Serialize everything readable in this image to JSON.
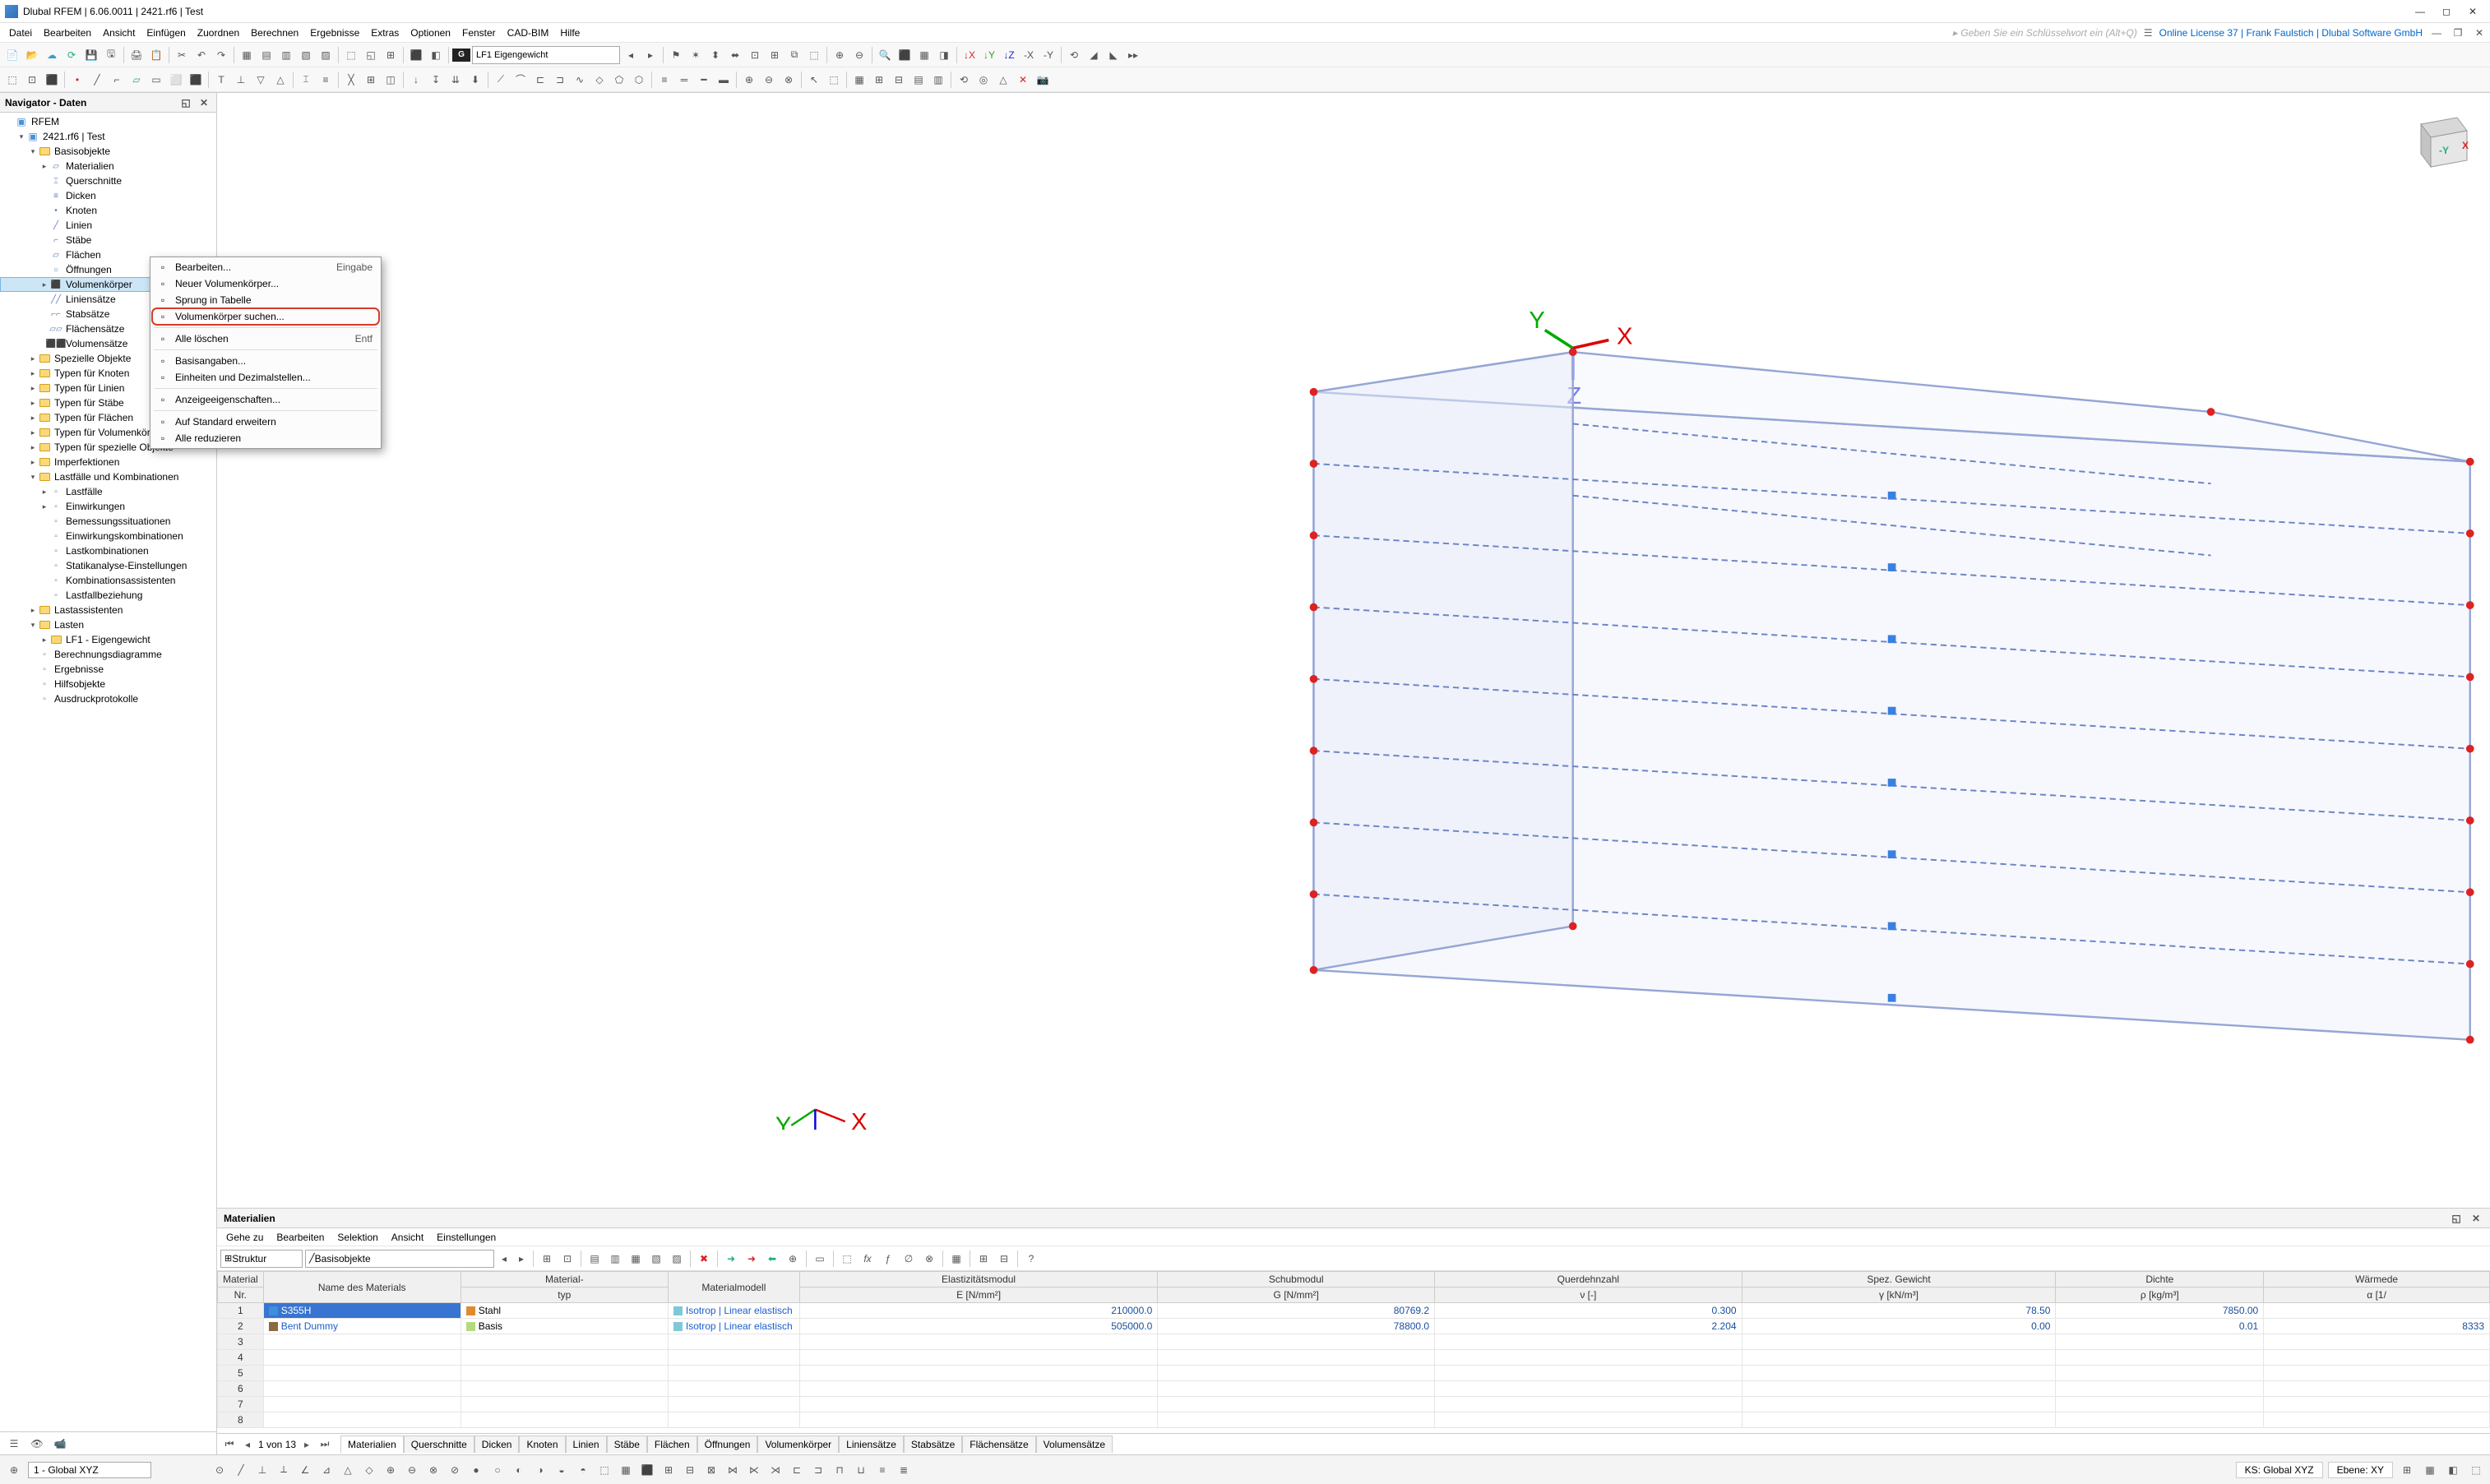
{
  "window": {
    "title": "Dlubal RFEM | 6.06.0011 | 2421.rf6 | Test"
  },
  "menubar": {
    "items": [
      "Datei",
      "Bearbeiten",
      "Ansicht",
      "Einfügen",
      "Zuordnen",
      "Berechnen",
      "Ergebnisse",
      "Extras",
      "Optionen",
      "Fenster",
      "CAD-BIM",
      "Hilfe"
    ],
    "search_placeholder": "Geben Sie ein Schlüsselwort ein (Alt+Q)",
    "license": "Online License 37 | Frank Faulstich | Dlubal Software GmbH"
  },
  "toolbar": {
    "load_combo": "LF1   Eigengewicht",
    "gtag": "G"
  },
  "navigator": {
    "title": "Navigator - Daten",
    "root": "RFEM",
    "project": "2421.rf6 | Test",
    "basis": "Basisobjekte",
    "basis_children": [
      "Materialien",
      "Querschnitte",
      "Dicken",
      "Knoten",
      "Linien",
      "Stäbe",
      "Flächen",
      "Öffnungen",
      "Volumenkörper",
      "Liniensätze",
      "Stabsätze",
      "Flächensätze",
      "Volumensätze"
    ],
    "folders_more": [
      "Spezielle Objekte",
      "Typen für Knoten",
      "Typen für Linien",
      "Typen für Stäbe",
      "Typen für Flächen",
      "Typen für Volumenkörper",
      "Typen für spezielle Objekte",
      "Imperfektionen"
    ],
    "lastfaelle": "Lastfälle und Kombinationen",
    "lastfaelle_children": [
      "Lastfälle",
      "Einwirkungen",
      "Bemessungssituationen",
      "Einwirkungskombinationen",
      "Lastkombinationen",
      "Statikanalyse-Einstellungen",
      "Kombinationsassistenten",
      "Lastfallbeziehung"
    ],
    "more_groups": [
      "Lastassistenten",
      "Lasten"
    ],
    "lf1": "LF1 - Eigengewicht",
    "tail": [
      "Berechnungsdiagramme",
      "Ergebnisse",
      "Hilfsobjekte",
      "Ausdruckprotokolle"
    ]
  },
  "context_menu": {
    "items": [
      {
        "label": "Bearbeiten...",
        "shortcut": "Eingabe"
      },
      {
        "label": "Neuer Volumenkörper..."
      },
      {
        "label": "Sprung in Tabelle"
      },
      {
        "label": "Volumenkörper suchen...",
        "hl": true
      },
      {
        "sep": true
      },
      {
        "label": "Alle löschen",
        "shortcut": "Entf"
      },
      {
        "sep": true
      },
      {
        "label": "Basisangaben..."
      },
      {
        "label": "Einheiten und Dezimalstellen..."
      },
      {
        "sep": true
      },
      {
        "label": "Anzeigeeigenschaften..."
      },
      {
        "sep": true
      },
      {
        "label": "Auf Standard erweitern"
      },
      {
        "label": "Alle reduzieren"
      }
    ]
  },
  "materials_panel": {
    "title": "Materialien",
    "menu": [
      "Gehe zu",
      "Bearbeiten",
      "Selektion",
      "Ansicht",
      "Einstellungen"
    ],
    "combo1": "Struktur",
    "combo2": "Basisobjekte",
    "headers": {
      "nr_top": "Material",
      "nr_bot": "Nr.",
      "name": "Name des Materials",
      "typ_top": "Material-",
      "typ_bot": "typ",
      "model": "Materialmodell",
      "e_top": "Elastizitätsmodul",
      "e_bot": "E [N/mm²]",
      "g_top": "Schubmodul",
      "g_bot": "G [N/mm²]",
      "nu_top": "Querdehnzahl",
      "nu_bot": "ν [-]",
      "gw_top": "Spez. Gewicht",
      "gw_bot": "γ [kN/m³]",
      "rho_top": "Dichte",
      "rho_bot": "ρ [kg/m³]",
      "a_top": "Wärmede",
      "a_bot": "α [1/"
    },
    "rows": [
      {
        "nr": "1",
        "color": "#3d8fdc",
        "name": "S355H",
        "typ": "Stahl",
        "typ_color": "#e08a2e",
        "model": "Isotrop | Linear elastisch",
        "model_color": "#7fc8d9",
        "e": "210000.0",
        "g": "80769.2",
        "nu": "0.300",
        "gw": "78.50",
        "rho": "7850.00",
        "sel": true
      },
      {
        "nr": "2",
        "color": "#8a6b3f",
        "name": "Bent Dummy",
        "typ": "Basis",
        "typ_color": "#b5d97f",
        "model": "Isotrop | Linear elastisch",
        "model_color": "#7fc8d9",
        "e": "505000.0",
        "g": "78800.0",
        "nu": "2.204",
        "gw": "0.00",
        "rho": "0.01",
        "alpha": "8333"
      }
    ],
    "empty_rows": [
      "3",
      "4",
      "5",
      "6",
      "7",
      "8"
    ],
    "pager": {
      "pos": "1 von 13",
      "tabs": [
        "Materialien",
        "Querschnitte",
        "Dicken",
        "Knoten",
        "Linien",
        "Stäbe",
        "Flächen",
        "Öffnungen",
        "Volumenkörper",
        "Liniensätze",
        "Stabsätze",
        "Flächensätze",
        "Volumensätze"
      ]
    }
  },
  "statusbar": {
    "cs": "1 - Global XYZ",
    "ks": "KS: Global XYZ",
    "ebene": "Ebene: XY"
  }
}
